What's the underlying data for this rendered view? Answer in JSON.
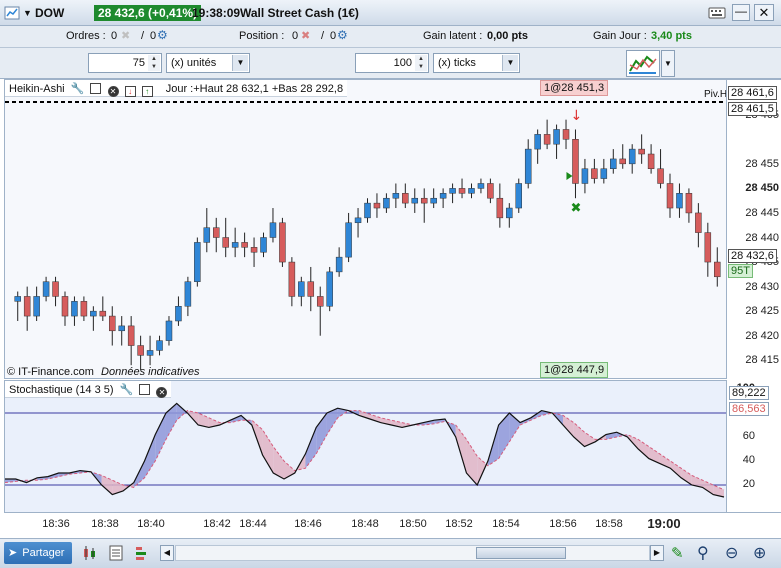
{
  "title_bar": {
    "instrument": "DOW",
    "price_change": "28 432,6 (+0,41%)",
    "clock": "19:38:09",
    "market_name": "Wall Street Cash (1€)"
  },
  "info_bar": {
    "orders_label": "Ordres :",
    "orders_a": "0",
    "orders_b": "0",
    "position_label": "Position :",
    "position_value": "0",
    "latent_label": "Gain latent :",
    "latent_value": "0,00 pts",
    "day_gain_label": "Gain Jour :",
    "day_gain_value": "3,40 pts"
  },
  "order_bar": {
    "quantity_value": "75",
    "quantity_unit": "(x) unités",
    "distance_value": "100",
    "distance_unit": "(x) ticks"
  },
  "price_panel": {
    "indicator_name": "Heikin-Ashi",
    "ohlc_text": "Jour :+Haut 28 632,1 +Bas 28 292,8",
    "order_tag_top": "1@28 451,3",
    "order_tag_bottom": "1@28 447,9",
    "pivot_label": "Piv.H",
    "watermark": "© IT-Finance.com",
    "watermark_note": "Données indicatives",
    "scale": {
      "ticks": [
        "28 465",
        "28 455",
        "28 450",
        "28 445",
        "28 440",
        "28 435",
        "28 430",
        "28 425",
        "28 420",
        "28 415"
      ],
      "pivot_price": "28 461,6",
      "order_price": "28 461,5",
      "current_price": "28 432,6",
      "countdown": "95T"
    }
  },
  "stoch_panel": {
    "indicator_name": "Stochastique (14 3 5)",
    "scale": {
      "ticks": [
        "100",
        "80",
        "60",
        "40",
        "20"
      ],
      "k_value": "89,222",
      "d_value": "86,563"
    }
  },
  "time_axis": [
    "18:36",
    "18:38",
    "18:40",
    "18:42",
    "18:44",
    "18:46",
    "18:48",
    "18:50",
    "18:52",
    "18:54",
    "18:56",
    "18:58",
    "19:00"
  ],
  "chart_data": {
    "type": "candlestick",
    "y_range": [
      28412,
      28468
    ],
    "candles": [
      [
        28427,
        28429,
        28423,
        28428
      ],
      [
        28428,
        28430,
        28421,
        28424
      ],
      [
        28424,
        28430,
        28423,
        28428
      ],
      [
        28428,
        28432,
        28427,
        28431
      ],
      [
        28431,
        28432,
        28426,
        28428
      ],
      [
        28428,
        28429,
        28422,
        28424
      ],
      [
        28424,
        28428,
        28422,
        28427
      ],
      [
        28427,
        28428,
        28423,
        28424
      ],
      [
        28424,
        28426,
        28421,
        28425
      ],
      [
        28425,
        28428,
        28423,
        28424
      ],
      [
        28424,
        28426,
        28418,
        28421
      ],
      [
        28421,
        28424,
        28418,
        28422
      ],
      [
        28422,
        28424,
        28414,
        28418
      ],
      [
        28418,
        28420,
        28413,
        28416
      ],
      [
        28416,
        28420,
        28414,
        28417
      ],
      [
        28417,
        28420,
        28416,
        28419
      ],
      [
        28419,
        28424,
        28418,
        28423
      ],
      [
        28423,
        28428,
        28422,
        28426
      ],
      [
        28426,
        28432,
        28424,
        28431
      ],
      [
        28431,
        28440,
        28430,
        28439
      ],
      [
        28439,
        28446,
        28437,
        28442
      ],
      [
        28442,
        28444,
        28437,
        28440
      ],
      [
        28440,
        28444,
        28436,
        28438
      ],
      [
        28438,
        28442,
        28436,
        28439
      ],
      [
        28439,
        28441,
        28436,
        28438
      ],
      [
        28438,
        28440,
        28434,
        28437
      ],
      [
        28437,
        28441,
        28436,
        28440
      ],
      [
        28440,
        28446,
        28439,
        28443
      ],
      [
        28443,
        28444,
        28434,
        28435
      ],
      [
        28435,
        28436,
        28426,
        28428
      ],
      [
        28428,
        28432,
        28426,
        28431
      ],
      [
        28431,
        28434,
        28425,
        28428
      ],
      [
        28428,
        28430,
        28420,
        28426
      ],
      [
        28426,
        28434,
        28425,
        28433
      ],
      [
        28433,
        28438,
        28432,
        28436
      ],
      [
        28436,
        28445,
        28435,
        28443
      ],
      [
        28443,
        28446,
        28440,
        28444
      ],
      [
        28444,
        28448,
        28443,
        28447
      ],
      [
        28447,
        28449,
        28444,
        28446
      ],
      [
        28446,
        28449,
        28445,
        28448
      ],
      [
        28448,
        28451,
        28446,
        28449
      ],
      [
        28449,
        28451,
        28446,
        28447
      ],
      [
        28447,
        28450,
        28445,
        28448
      ],
      [
        28448,
        28450,
        28443,
        28447
      ],
      [
        28447,
        28450,
        28446,
        28448
      ],
      [
        28448,
        28450,
        28446,
        28449
      ],
      [
        28449,
        28451,
        28447,
        28450
      ],
      [
        28450,
        28452,
        28448,
        28449
      ],
      [
        28449,
        28451,
        28448,
        28450
      ],
      [
        28450,
        28452,
        28449,
        28451
      ],
      [
        28451,
        28452,
        28447,
        28448
      ],
      [
        28448,
        28451,
        28442,
        28444
      ],
      [
        28444,
        28447,
        28442,
        28446
      ],
      [
        28446,
        28452,
        28445,
        28451
      ],
      [
        28451,
        28460,
        28450,
        28458
      ],
      [
        28458,
        28462,
        28455,
        28461
      ],
      [
        28461,
        28464,
        28458,
        28459
      ],
      [
        28459,
        28463,
        28456,
        28462
      ],
      [
        28462,
        28464,
        28458,
        28460
      ],
      [
        28460,
        28462,
        28448,
        28451
      ],
      [
        28451,
        28456,
        28449,
        28454
      ],
      [
        28454,
        28456,
        28451,
        28452
      ],
      [
        28452,
        28456,
        28451,
        28454
      ],
      [
        28454,
        28458,
        28453,
        28456
      ],
      [
        28456,
        28459,
        28454,
        28455
      ],
      [
        28455,
        28459,
        28453,
        28458
      ],
      [
        28458,
        28461,
        28455,
        28457
      ],
      [
        28457,
        28459,
        28453,
        28454
      ],
      [
        28454,
        28458,
        28450,
        28451
      ],
      [
        28451,
        28453,
        28444,
        28446
      ],
      [
        28446,
        28451,
        28444,
        28449
      ],
      [
        28449,
        28450,
        28443,
        28445
      ],
      [
        28445,
        28447,
        28438,
        28441
      ],
      [
        28441,
        28443,
        28432,
        28435
      ],
      [
        28435,
        28438,
        28430,
        28432
      ]
    ],
    "stoch_k": [
      25,
      25,
      22,
      26,
      27,
      30,
      30,
      32,
      31,
      20,
      12,
      15,
      22,
      40,
      62,
      80,
      88,
      80,
      70,
      68,
      70,
      74,
      78,
      70,
      45,
      30,
      25,
      30,
      46,
      68,
      80,
      84,
      82,
      78,
      75,
      72,
      70,
      68,
      70,
      72,
      74,
      75,
      60,
      30,
      20,
      40,
      70,
      80,
      72,
      76,
      82,
      80,
      70,
      60,
      52,
      56,
      62,
      64,
      60,
      50,
      42,
      38,
      34,
      26,
      20,
      18,
      12,
      10
    ],
    "stoch_d": [
      22,
      23,
      24,
      24,
      25,
      27,
      29,
      30,
      31,
      28,
      24,
      20,
      18,
      26,
      40,
      58,
      74,
      82,
      80,
      76,
      72,
      72,
      74,
      74,
      66,
      52,
      40,
      32,
      34,
      46,
      62,
      76,
      82,
      82,
      79,
      76,
      74,
      72,
      70,
      70,
      71,
      73,
      70,
      58,
      44,
      36,
      42,
      56,
      70,
      74,
      78,
      80,
      78,
      72,
      64,
      58,
      58,
      60,
      62,
      58,
      52,
      46,
      40,
      34,
      28,
      24,
      20,
      16
    ]
  },
  "bottom_bar": {
    "share_label": "Partager"
  },
  "colors": {
    "bull": "#2f86d6",
    "bear": "#d65c5c",
    "day_gain": "#1a8a1a",
    "price_change_bg": "#1e8a2e"
  }
}
